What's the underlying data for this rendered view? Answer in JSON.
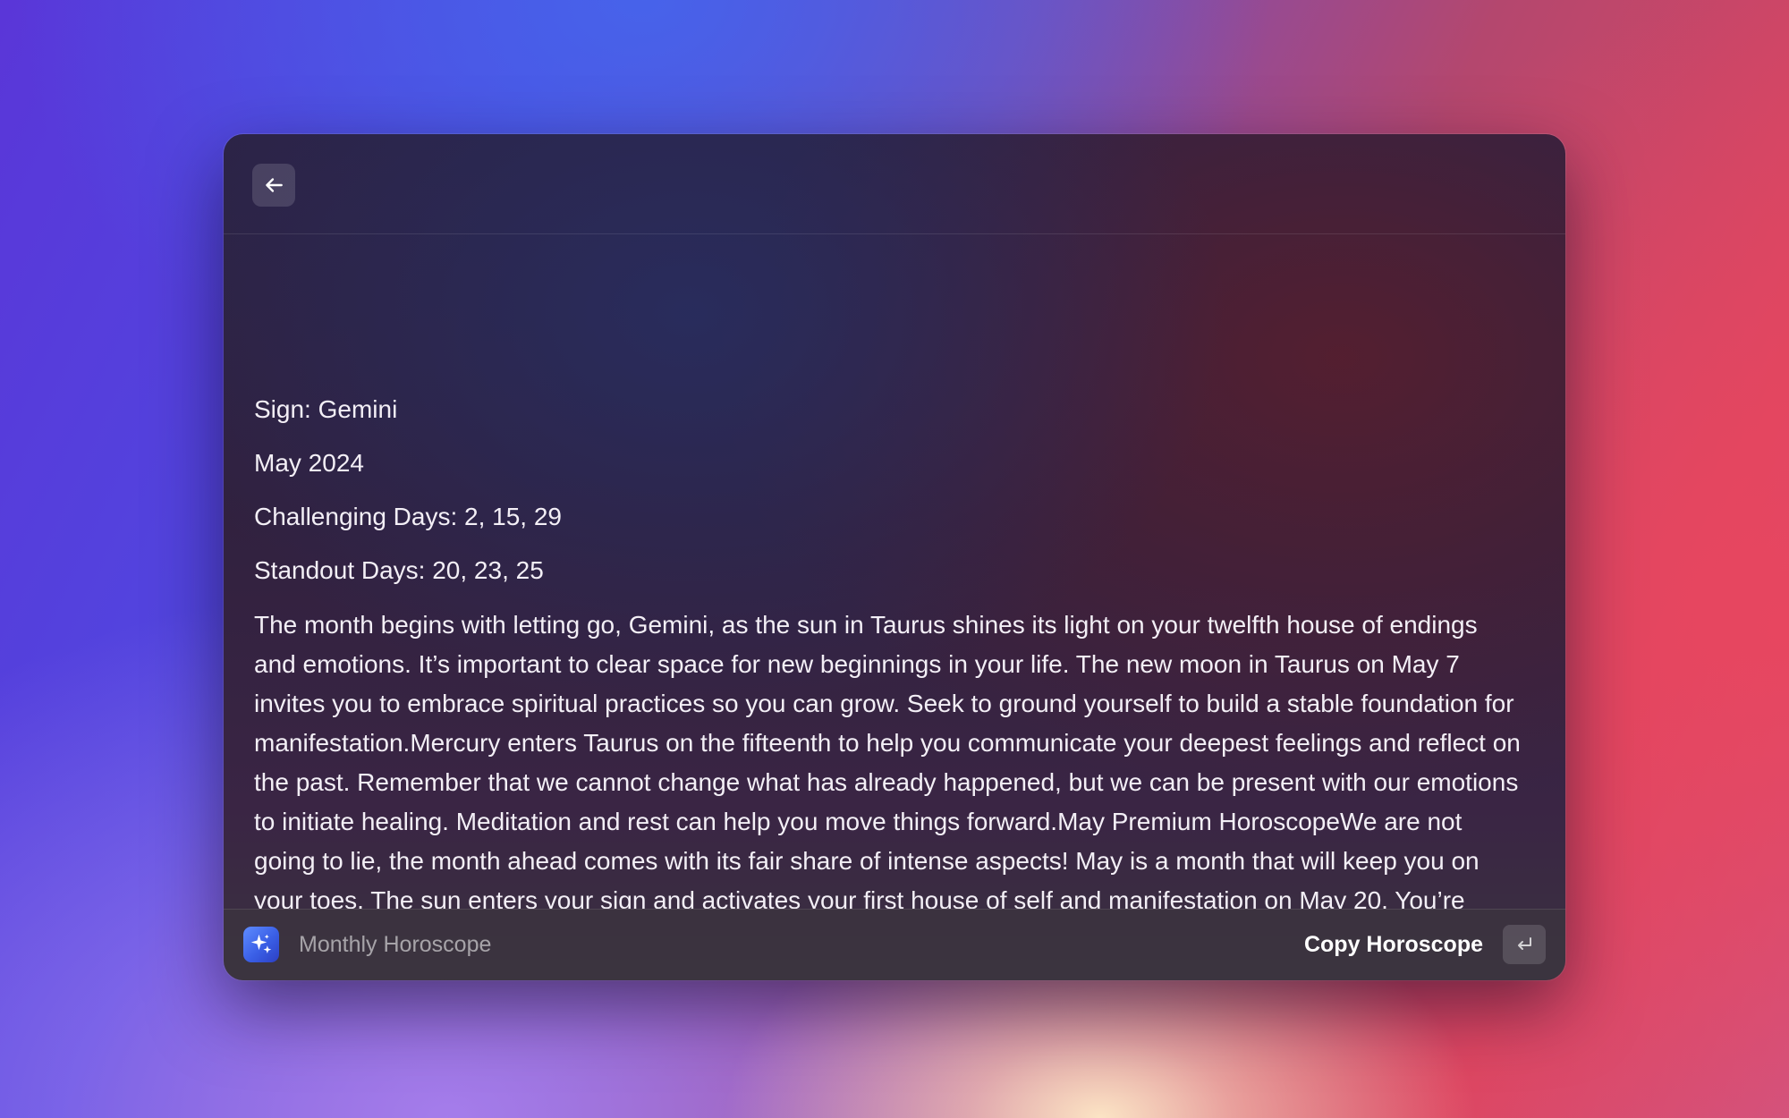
{
  "header": {
    "back_icon": "arrow-left-icon"
  },
  "horoscope": {
    "sign_line": "Sign: Gemini",
    "month_line": "May 2024",
    "challenging_line": "Challenging Days: 2, 15, 29",
    "standout_line": "Standout Days: 20, 23, 25",
    "body": "The month begins with letting go, Gemini, as the sun in Taurus shines its light on your twelfth house of endings and emotions. It’s important to clear space for new beginnings in your life. The new moon in Taurus on May 7 invites you to embrace spiritual practices so you can grow. Seek to ground yourself to build a stable foundation for manifestation.Mercury enters Taurus on the fifteenth to help you communicate your deepest feelings and reflect on the past. Remember that we cannot change what has already happened, but we can be present with our emotions to initiate healing. Meditation and rest can help you move things forward.May Premium HoroscopeWe are not going to lie, the month ahead comes with its fair share of intense aspects! May is a month that will keep you on your toes. The sun enters your sign and activates your first house of self and manifestation on May 20. You’re invited to embrace your authenticity. Showcasing your personality will bring new opportunities as well as positive attention. All eyes are on you and others are drawn to your energy.The full moon in Sagittarius on the twenty-third"
  },
  "footer": {
    "app_icon": "sparkles-icon",
    "app_name": "Monthly Horoscope",
    "action_label": "Copy Horoscope",
    "action_key_icon": "return-key-icon"
  },
  "colors": {
    "app_icon_accent": "#3a5fe6",
    "window_background": "#2f2342",
    "text_primary": "#f3eff6"
  }
}
